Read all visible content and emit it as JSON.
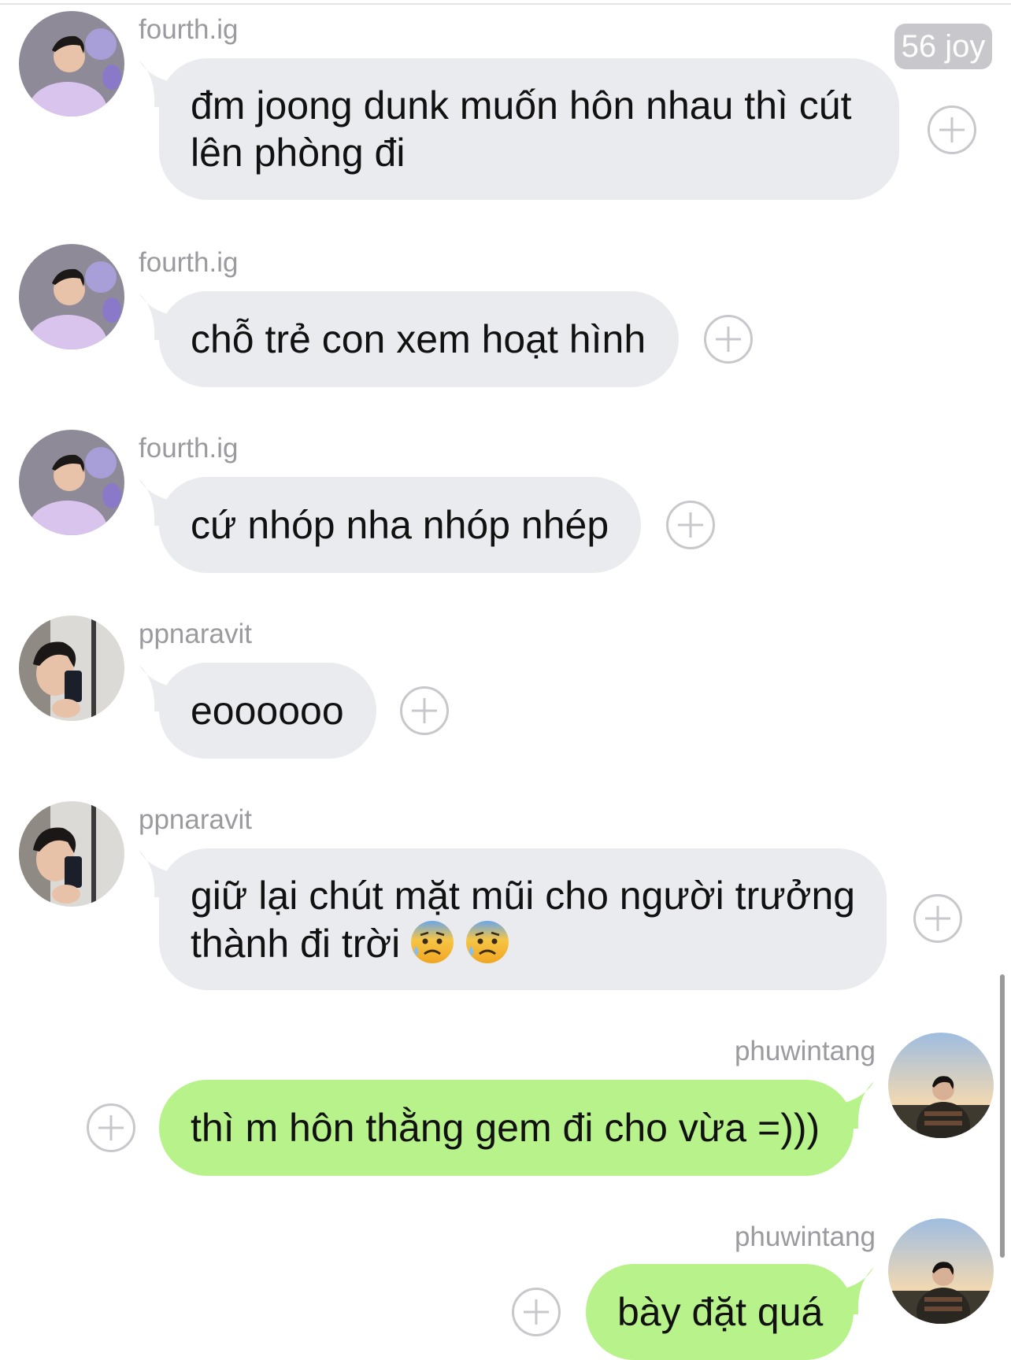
{
  "badge": "56 joy",
  "messages": [
    {
      "user": "fourth.ig",
      "lines": [
        "đm joong dunk muốn hôn nhau thì cút",
        "lên phòng đi"
      ],
      "side": "incoming"
    },
    {
      "user": "fourth.ig",
      "lines": [
        "chỗ trẻ con xem hoạt hình"
      ],
      "side": "incoming"
    },
    {
      "user": "fourth.ig",
      "lines": [
        "cứ nhóp nha nhóp nhép"
      ],
      "side": "incoming"
    },
    {
      "user": "ppnaravit",
      "lines": [
        "eoooooo"
      ],
      "side": "incoming"
    },
    {
      "user": "ppnaravit",
      "lines": [
        "giữ lại chút mặt mũi cho người trưởng",
        "thành đi trời"
      ],
      "emojis": [
        "anxious-face-with-sweat",
        "anxious-face-with-sweat"
      ],
      "side": "incoming"
    },
    {
      "user": "phuwintang",
      "lines": [
        "thì m hôn thằng gem đi cho vừa =)))"
      ],
      "side": "outgoing"
    },
    {
      "user": "phuwintang",
      "lines": [
        "bày đặt quá"
      ],
      "side": "outgoing"
    }
  ],
  "colors": {
    "incoming_bubble": "#e9ebee",
    "outgoing_bubble": "#b8f28a",
    "username": "#9a9a9f",
    "badge_bg": "#c7c7cc"
  },
  "icons": [
    "add-reaction-icon",
    "anxious-face-with-sweat-emoji"
  ]
}
